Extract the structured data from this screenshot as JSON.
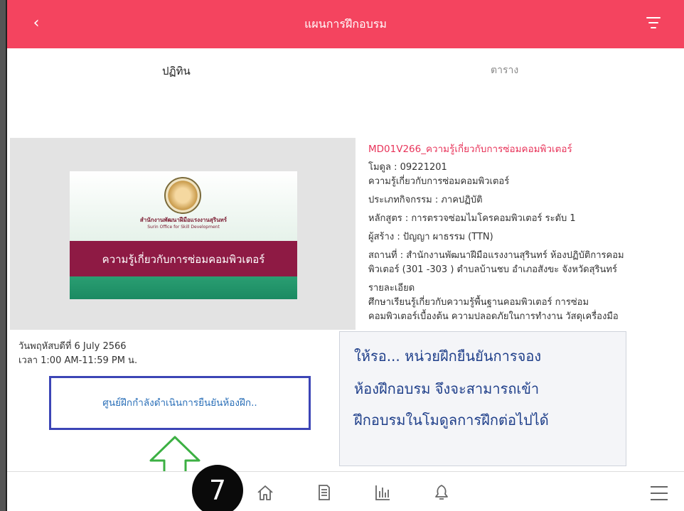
{
  "header": {
    "title": "แผนการฝึกอบรม",
    "back_icon": "chevron-left-icon",
    "filter_icon": "filter-icon"
  },
  "tabs": [
    {
      "label": "ปฏิทิน",
      "active": true
    },
    {
      "label": "ตาราง",
      "active": false
    }
  ],
  "course": {
    "cover": {
      "org_th": "สำนักงานพัฒนาฝีมือแรงงานสุรินทร์",
      "org_en": "Surin Office for Skill Development",
      "title": "ความรู้เกี่ยวกับการซ่อมคอมพิวเตอร์"
    },
    "code_title": "MD01V266_ความรู้เกี่ยวกับการซ่อมคอมพิวเตอร์",
    "module": "โมดูล : 09221201",
    "module_name": "ความรู้เกี่ยวกับการซ่อมคอมพิวเตอร์",
    "activity_type": "ประเภทกิจกรรม : ภาคปฏิบัติ",
    "curriculum": "หลักสูตร : การตรวจซ่อมไมโครคอมพิวเตอร์ ระดับ 1",
    "creator": "ผู้สร้าง : ปัญญา ผาธรรม (TTN)",
    "location_1": "สถานที่ : สำนักงานพัฒนาฝีมือแรงงานสุรินทร์ ห้องปฏิบัติการคอม",
    "location_2": "พิวเตอร์ (301 -303 ) ตำบลบ้านชบ อำเภอสังขะ  จังหวัดสุรินทร์",
    "details_label": "รายละเอียด",
    "details_1": "ศึกษาเรียนรู้เกี่ยวกับความรู้พื้นฐานคอมพิวเตอร์  การซ่อม",
    "details_2": "คอมพิวเตอร์เบื้องต้น  ความปลอดภัยในการทำงาน  วัสดุเครื่องมือ"
  },
  "schedule": {
    "date": "วันพฤหัสบดีที่ 6 July 2566",
    "time": "เวลา 1:00 AM-11:59 PM น."
  },
  "status_button": "ศูนย์ฝึกกำลังดำเนินการยืนยันห้องฝึก..",
  "note": {
    "line1": "ให้รอ... หน่วยฝึกยืนยันการจอง",
    "line2": "ห้องฝึกอบรม  จึงจะสามารถเข้า",
    "line3": "ฝึกอบรมในโมดูลการฝึกต่อไปได้"
  },
  "step_badge": "7",
  "bottom_nav": [
    "home-icon",
    "document-icon",
    "bar-chart-icon",
    "bell-icon",
    "menu-icon"
  ],
  "colors": {
    "header": "#f4445f",
    "accent_text": "#e8345a",
    "status_border": "#3c45b6",
    "status_text": "#2a6fb8",
    "note_text": "#1f3f8a",
    "arrow": "#3cb043"
  }
}
